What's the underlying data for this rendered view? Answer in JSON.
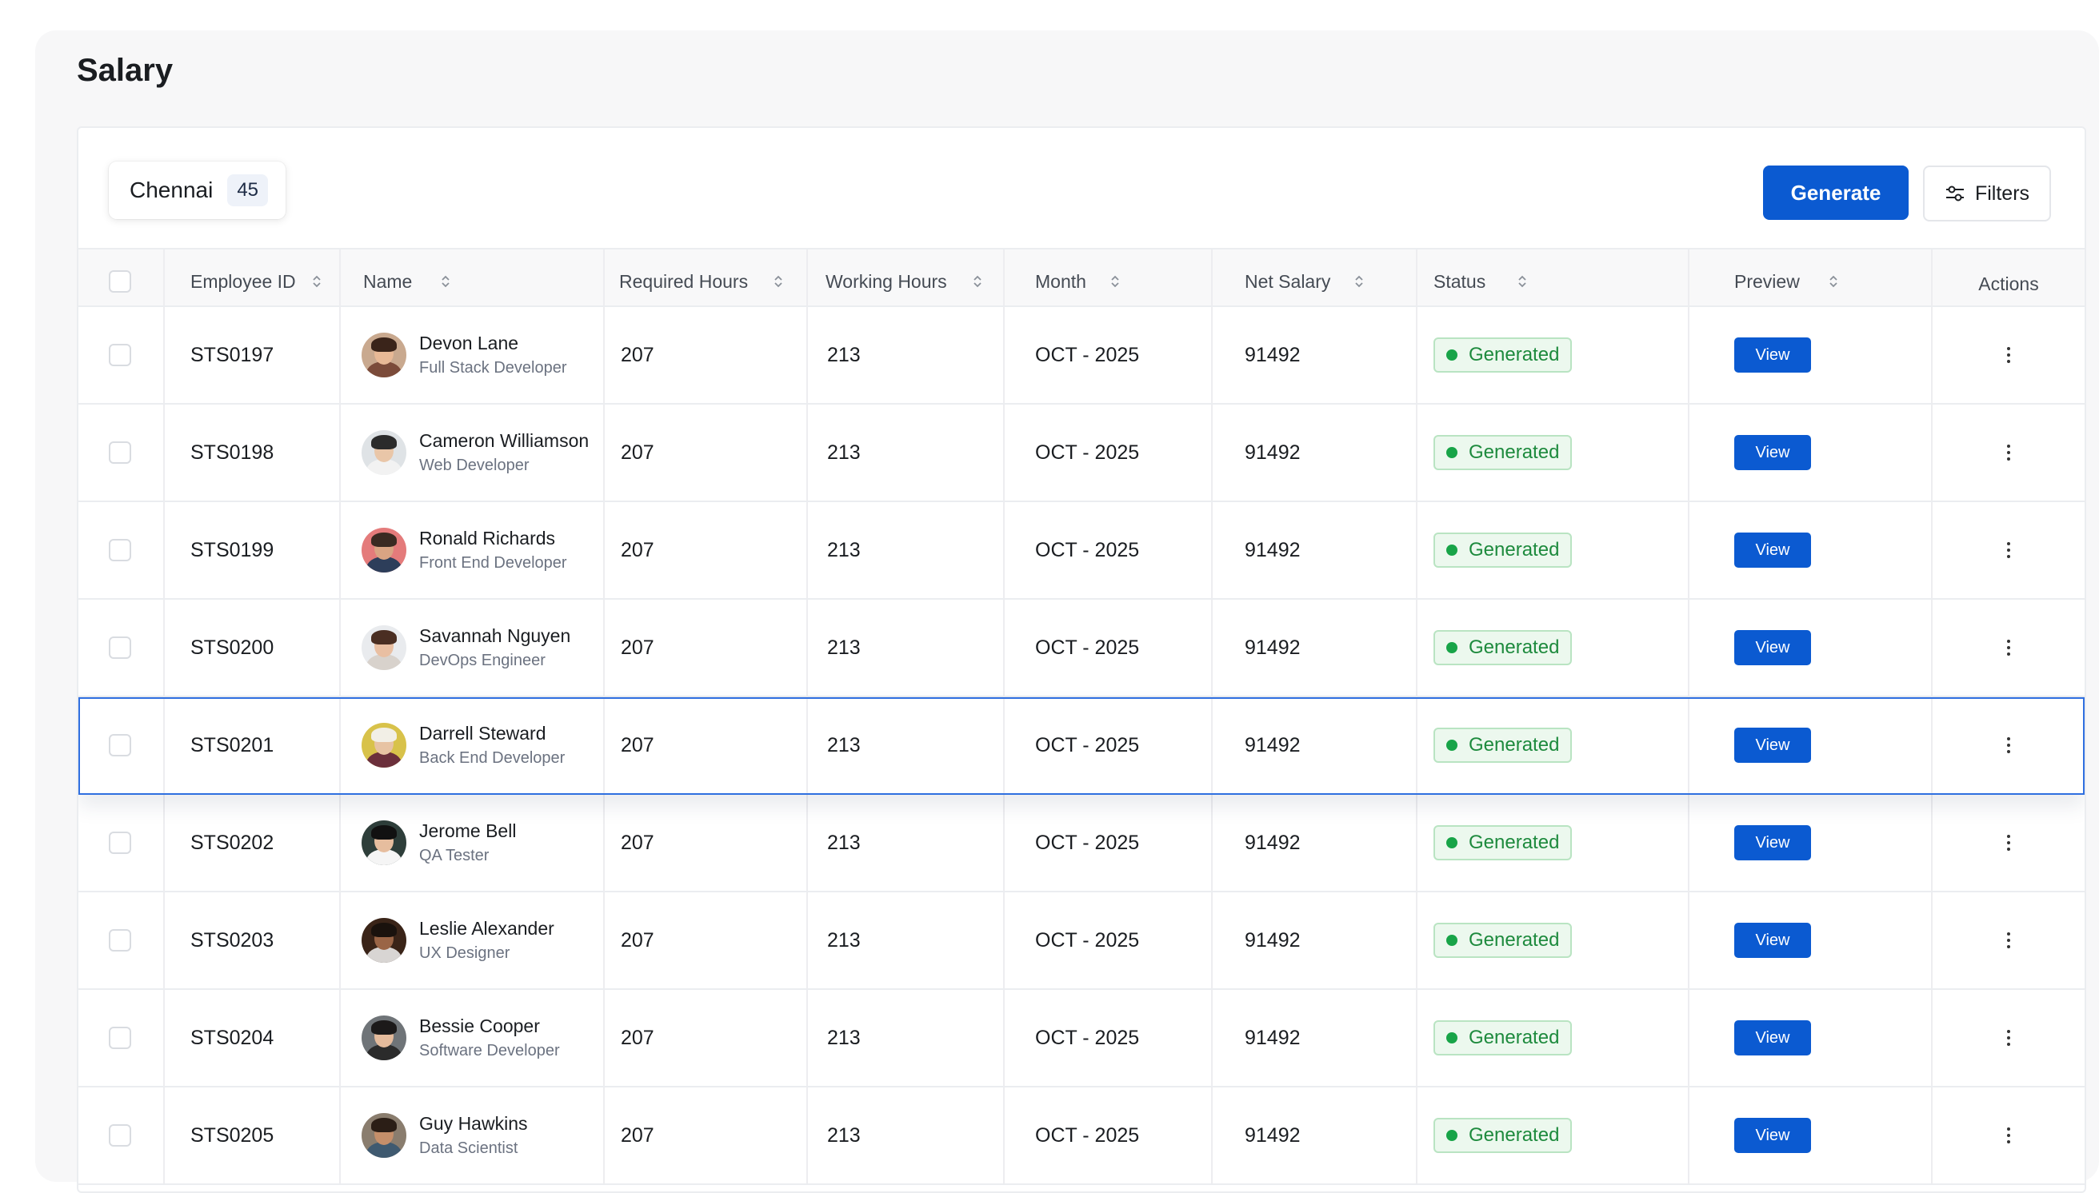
{
  "page": {
    "title": "Salary"
  },
  "location": {
    "name": "Chennai",
    "count": "45"
  },
  "toolbar": {
    "generate_label": "Generate",
    "filters_label": "Filters"
  },
  "table": {
    "headers": {
      "employee_id": "Employee ID",
      "name": "Name",
      "required_hours": "Required Hours",
      "working_hours": "Working Hours",
      "month": "Month",
      "net_salary": "Net Salary",
      "status": "Status",
      "preview": "Preview",
      "actions": "Actions"
    },
    "rows": [
      {
        "id": "STS0197",
        "name": "Devon Lane",
        "role": "Full Stack Developer",
        "required": "207",
        "working": "213",
        "month": "OCT - 2025",
        "net": "91492",
        "status": "Generated",
        "preview": "View",
        "avatar_colors": {
          "bg": "#c9a98f",
          "skin": "#e8b996",
          "hair": "#3a241a",
          "shirt": "#7b4b3a"
        }
      },
      {
        "id": "STS0198",
        "name": "Cameron Williamson",
        "role": "Web Developer",
        "required": "207",
        "working": "213",
        "month": "OCT - 2025",
        "net": "91492",
        "status": "Generated",
        "preview": "View",
        "avatar_colors": {
          "bg": "#dfe3e6",
          "skin": "#e9c6a8",
          "hair": "#2b2b2b",
          "shirt": "#f2f2f2"
        }
      },
      {
        "id": "STS0199",
        "name": "Ronald Richards",
        "role": "Front End Developer",
        "required": "207",
        "working": "213",
        "month": "OCT - 2025",
        "net": "91492",
        "status": "Generated",
        "preview": "View",
        "avatar_colors": {
          "bg": "#e47b7b",
          "skin": "#d9a483",
          "hair": "#3a2a22",
          "shirt": "#2d3e5a"
        }
      },
      {
        "id": "STS0200",
        "name": "Savannah Nguyen",
        "role": "DevOps Engineer",
        "required": "207",
        "working": "213",
        "month": "OCT - 2025",
        "net": "91492",
        "status": "Generated",
        "preview": "View",
        "avatar_colors": {
          "bg": "#e9ebee",
          "skin": "#e9bfa2",
          "hair": "#4a2e22",
          "shirt": "#d8d2cc"
        }
      },
      {
        "id": "STS0201",
        "name": "Darrell Steward",
        "role": "Back End Developer",
        "required": "207",
        "working": "213",
        "month": "OCT - 2025",
        "net": "91492",
        "status": "Generated",
        "preview": "View",
        "avatar_colors": {
          "bg": "#d8c24a",
          "skin": "#e7c3a3",
          "hair": "#f2efe6",
          "shirt": "#6b2f3b"
        }
      },
      {
        "id": "STS0202",
        "name": "Jerome Bell",
        "role": "QA Tester",
        "required": "207",
        "working": "213",
        "month": "OCT - 2025",
        "net": "91492",
        "status": "Generated",
        "preview": "View",
        "avatar_colors": {
          "bg": "#2e3e3a",
          "skin": "#e6bd9e",
          "hair": "#111111",
          "shirt": "#f5f5f5"
        }
      },
      {
        "id": "STS0203",
        "name": "Leslie Alexander",
        "role": "UX Designer",
        "required": "207",
        "working": "213",
        "month": "OCT - 2025",
        "net": "91492",
        "status": "Generated",
        "preview": "View",
        "avatar_colors": {
          "bg": "#3a2418",
          "skin": "#9a6546",
          "hair": "#1a120d",
          "shirt": "#d8d5d3"
        }
      },
      {
        "id": "STS0204",
        "name": "Bessie Cooper",
        "role": "Software Developer",
        "required": "207",
        "working": "213",
        "month": "OCT - 2025",
        "net": "91492",
        "status": "Generated",
        "preview": "View",
        "avatar_colors": {
          "bg": "#6f7478",
          "skin": "#e4bb9c",
          "hair": "#1c1a1a",
          "shirt": "#2b2b2b"
        }
      },
      {
        "id": "STS0205",
        "name": "Guy Hawkins",
        "role": "Data Scientist",
        "required": "207",
        "working": "213",
        "month": "OCT - 2025",
        "net": "91492",
        "status": "Generated",
        "preview": "View",
        "avatar_colors": {
          "bg": "#8a7d6e",
          "skin": "#c58f6a",
          "hair": "#2b1e16",
          "shirt": "#3f5a70"
        }
      }
    ],
    "selected_row_index": 4
  },
  "colors": {
    "accent": "#0b5ad1",
    "status_green": "#1d8a3d",
    "status_bg": "#ecf8ee",
    "selection_border": "#2f6fe0"
  },
  "icons": {
    "sort": "sort-icon",
    "filters": "sliders-icon",
    "actions": "more-vertical-icon"
  }
}
